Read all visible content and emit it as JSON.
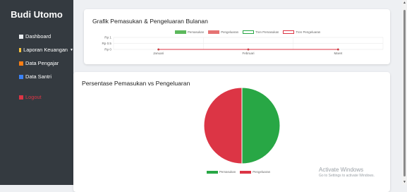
{
  "sidebar": {
    "brand": "Budi Utomo",
    "items": [
      {
        "label": "Dashboard",
        "icon": "dashboard-icon",
        "color": "#e9ecef"
      },
      {
        "label": "Laporan Keuangan",
        "icon": "money-icon",
        "color": "#f6c23e",
        "caret": "▼"
      },
      {
        "label": "Data Pengajar",
        "icon": "teacher-icon",
        "color": "#fd7e14"
      },
      {
        "label": "Data Santri",
        "icon": "student-icon",
        "color": "#3b82f6"
      }
    ],
    "logout": {
      "label": "Logout",
      "icon": "logout-icon",
      "color": "#dc3545"
    }
  },
  "line_card": {
    "title": "Grafik Pemasukan & Pengeluaran Bulanan",
    "legend": [
      {
        "label": "Pemasukan",
        "color": "#5cb85c",
        "style": "filled"
      },
      {
        "label": "Pengeluaran",
        "color": "#e57373",
        "style": "filled"
      },
      {
        "label": "Tren Pemasukan",
        "color": "#28a745",
        "style": "outline"
      },
      {
        "label": "Tren Pengeluaran",
        "color": "#dc3545",
        "style": "outline"
      }
    ]
  },
  "pie_card": {
    "title": "Persentase Pemasukan vs Pengeluaran",
    "legend": [
      {
        "label": "Pemasukan",
        "color": "#28a745"
      },
      {
        "label": "Pengeluaran",
        "color": "#dc3545"
      }
    ]
  },
  "watermark": {
    "line1": "Activate Windows",
    "line2": "Go to Settings to activate Windows."
  },
  "chart_data": [
    {
      "type": "line",
      "title": "Grafik Pemasukan & Pengeluaran Bulanan",
      "categories": [
        "Januari",
        "Februari",
        "Maret"
      ],
      "y_ticks": [
        "Rp 1",
        "Rp 0.5",
        "Rp 0"
      ],
      "ylim": [
        0,
        1
      ],
      "series": [
        {
          "name": "Pemasukan",
          "values": [
            0,
            0,
            0
          ],
          "color": "#28a745"
        },
        {
          "name": "Pengeluaran",
          "values": [
            0,
            0,
            0
          ],
          "color": "#dc3545"
        },
        {
          "name": "Tren Pemasukan",
          "values": [
            0,
            0,
            0
          ],
          "color": "#28a745"
        },
        {
          "name": "Tren Pengeluaran",
          "values": [
            0,
            0,
            0
          ],
          "color": "#dc3545"
        }
      ],
      "grid": true,
      "legend": "top"
    },
    {
      "type": "pie",
      "title": "Persentase Pemasukan vs Pengeluaran",
      "categories": [
        "Pemasukan",
        "Pengeluaran"
      ],
      "values": [
        50,
        50
      ],
      "colors": [
        "#28a745",
        "#dc3545"
      ],
      "legend": "bottom"
    }
  ]
}
